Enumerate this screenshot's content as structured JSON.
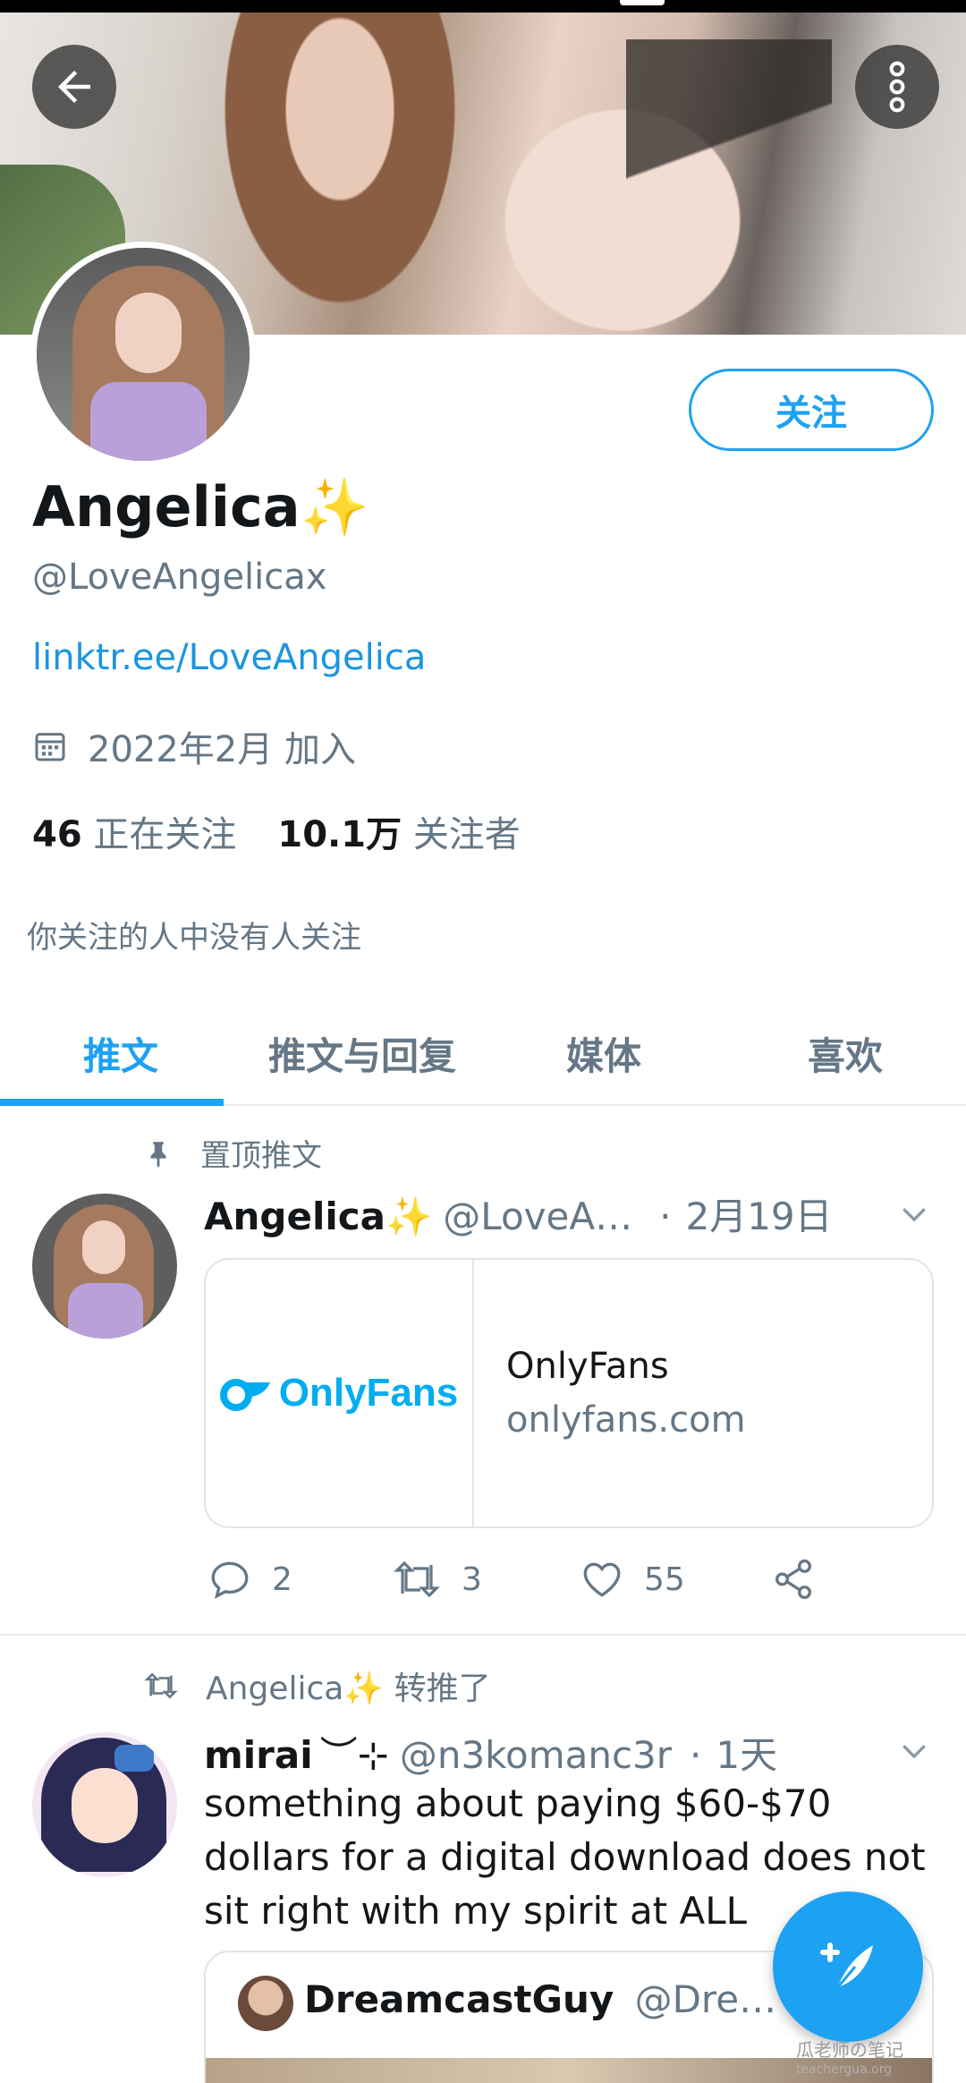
{
  "profile": {
    "name": "Angelica",
    "sparkle": "✨",
    "handle": "@LoveAngelicax",
    "website": "linktr.ee/LoveAngelica",
    "joined": "2022年2月 加入",
    "following_count": "46",
    "following_label": "正在关注",
    "followers_count": "10.1万",
    "followers_label": "关注者",
    "mutual_text": "你关注的人中没有人关注",
    "follow_button": "关注"
  },
  "tabs": [
    {
      "label": "推文",
      "active": true
    },
    {
      "label": "推文与回复",
      "active": false
    },
    {
      "label": "媒体",
      "active": false
    },
    {
      "label": "喜欢",
      "active": false
    }
  ],
  "pinned_tweet": {
    "pin_label": "置顶推文",
    "name": "Angelica✨",
    "handle": "@LoveA…",
    "separator": "·",
    "date": "2月19日",
    "card": {
      "logo_text": "OnlyFans",
      "title": "OnlyFans",
      "domain": "onlyfans.com"
    },
    "replies": "2",
    "retweets": "3",
    "likes": "55"
  },
  "retweet": {
    "retweeted_by": "Angelica✨ 转推了",
    "name": "mirai",
    "name_suffix": "︶⊹",
    "handle": "@n3komanc3r",
    "separator": "·",
    "date": "1天",
    "text": "something about paying $60-$70 dollars for a digital download does not sit right with my spirit at ALL",
    "quote": {
      "name": "DreamcastGuy",
      "handle": "@Dre…"
    }
  },
  "watermark": {
    "line1": "瓜老师の笔记",
    "line2": "teachergua.org"
  },
  "colors": {
    "accent": "#1da1f2",
    "text_secondary": "#657786",
    "link": "#1b95e0"
  },
  "icons": [
    "back-arrow-icon",
    "more-vertical-icon",
    "calendar-icon",
    "pin-icon",
    "reply-icon",
    "retweet-icon",
    "like-icon",
    "share-icon",
    "chevron-down-icon",
    "compose-icon"
  ]
}
